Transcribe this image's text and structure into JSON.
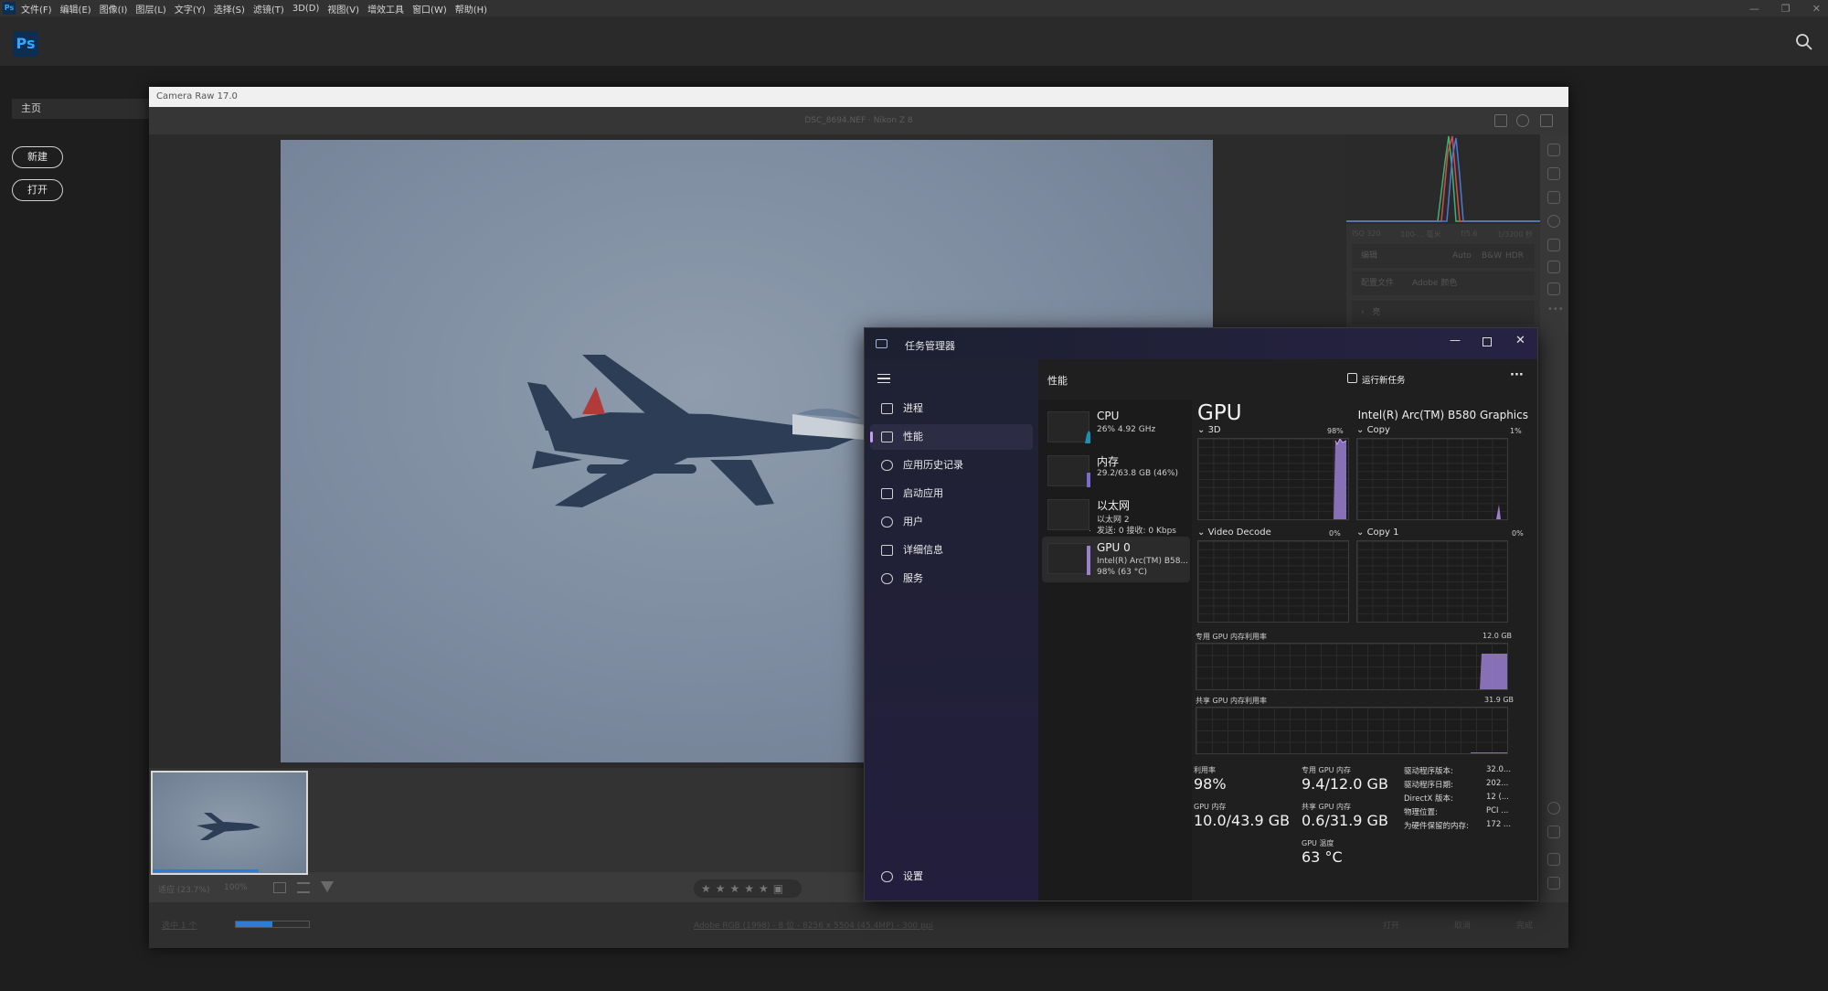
{
  "menubar": {
    "items": [
      "文件(F)",
      "编辑(E)",
      "图像(I)",
      "图层(L)",
      "文字(Y)",
      "选择(S)",
      "滤镜(T)",
      "3D(D)",
      "视图(V)",
      "增效工具",
      "窗口(W)",
      "帮助(H)"
    ]
  },
  "ps": {
    "logo": "Ps",
    "home_label": "主页",
    "new_label": "新建",
    "open_label": "打开"
  },
  "camera_raw": {
    "window_title": "Camera Raw 17.0",
    "file_info": "DSC_8694.NEF  ·  Nikon Z 8",
    "exif": {
      "iso": "ISO 320",
      "lens": "100-... 毫米",
      "aperture": "f/5.6",
      "shutter": "1/3200 秒"
    },
    "panel": {
      "edit_label": "编辑",
      "auto": "Auto",
      "bw": "B&W",
      "hdr": "HDR",
      "profile_label": "配置文件",
      "profile_value": "Adobe 颜色",
      "section_label": "亮"
    },
    "toolbar": {
      "fit": "适应 (23.7%)",
      "zoom": "100%"
    },
    "bottom": {
      "selected": "选中 1 个",
      "info_link": "Adobe RGB (1998) - 8 位 - 8256 x 5504 (45.4MP) - 300 ppi",
      "open": "打开",
      "cancel": "取消",
      "done": "完成"
    }
  },
  "task_manager": {
    "title": "任务管理器",
    "nav": [
      {
        "label": "进程",
        "icon": "processes-icon"
      },
      {
        "label": "性能",
        "icon": "performance-icon",
        "selected": true
      },
      {
        "label": "应用历史记录",
        "icon": "history-icon"
      },
      {
        "label": "启动应用",
        "icon": "startup-icon"
      },
      {
        "label": "用户",
        "icon": "users-icon"
      },
      {
        "label": "详细信息",
        "icon": "details-icon"
      },
      {
        "label": "服务",
        "icon": "services-icon"
      }
    ],
    "settings_label": "设置",
    "header_title": "性能",
    "run_new_task": "运行新任务",
    "resources": [
      {
        "name": "CPU",
        "line1": "26%  4.92 GHz",
        "line2": ""
      },
      {
        "name": "内存",
        "line1": "29.2/63.8 GB (46%)",
        "line2": ""
      },
      {
        "name": "以太网",
        "line1": "以太网 2",
        "line2": "发送: 0 接收: 0 Kbps"
      },
      {
        "name": "GPU 0",
        "line1": "Intel(R) Arc(TM) B58...",
        "line2": "98%  (63 °C)",
        "selected": true
      }
    ],
    "gpu": {
      "title": "GPU",
      "adapter": "Intel(R) Arc(TM) B580 Graphics",
      "engines": [
        {
          "name": "3D",
          "pct": "98%"
        },
        {
          "name": "Copy",
          "pct": "1%"
        },
        {
          "name": "Video Decode",
          "pct": "0%"
        },
        {
          "name": "Copy 1",
          "pct": "0%"
        }
      ],
      "dedicated_label": "专用 GPU 内存利用率",
      "dedicated_max": "12.0 GB",
      "dedicated_level": 0.78,
      "shared_label": "共享 GPU 内存利用率",
      "shared_max": "31.9 GB",
      "shared_level": 0.02,
      "stats": {
        "util_label": "利用率",
        "util": "98%",
        "ded_label": "专用 GPU 内存",
        "ded": "9.4/12.0 GB",
        "gpumem_label": "GPU 内存",
        "gpumem": "10.0/43.9 GB",
        "shr_label": "共享 GPU 内存",
        "shr": "0.6/31.9 GB",
        "temp_label": "GPU 温度",
        "temp": "63 °C"
      },
      "info": [
        {
          "k": "驱动程序版本:",
          "v": "32.0..."
        },
        {
          "k": "驱动程序日期:",
          "v": "202..."
        },
        {
          "k": "DirectX 版本:",
          "v": "12 (..."
        },
        {
          "k": "物理位置:",
          "v": "PCI ..."
        },
        {
          "k": "为硬件保留的内存:",
          "v": "172 ..."
        }
      ]
    }
  },
  "colors": {
    "ps_blue": "#31a8ff",
    "accent_purple": "#c59cf0",
    "graph_fill": "#9b7fd1"
  }
}
